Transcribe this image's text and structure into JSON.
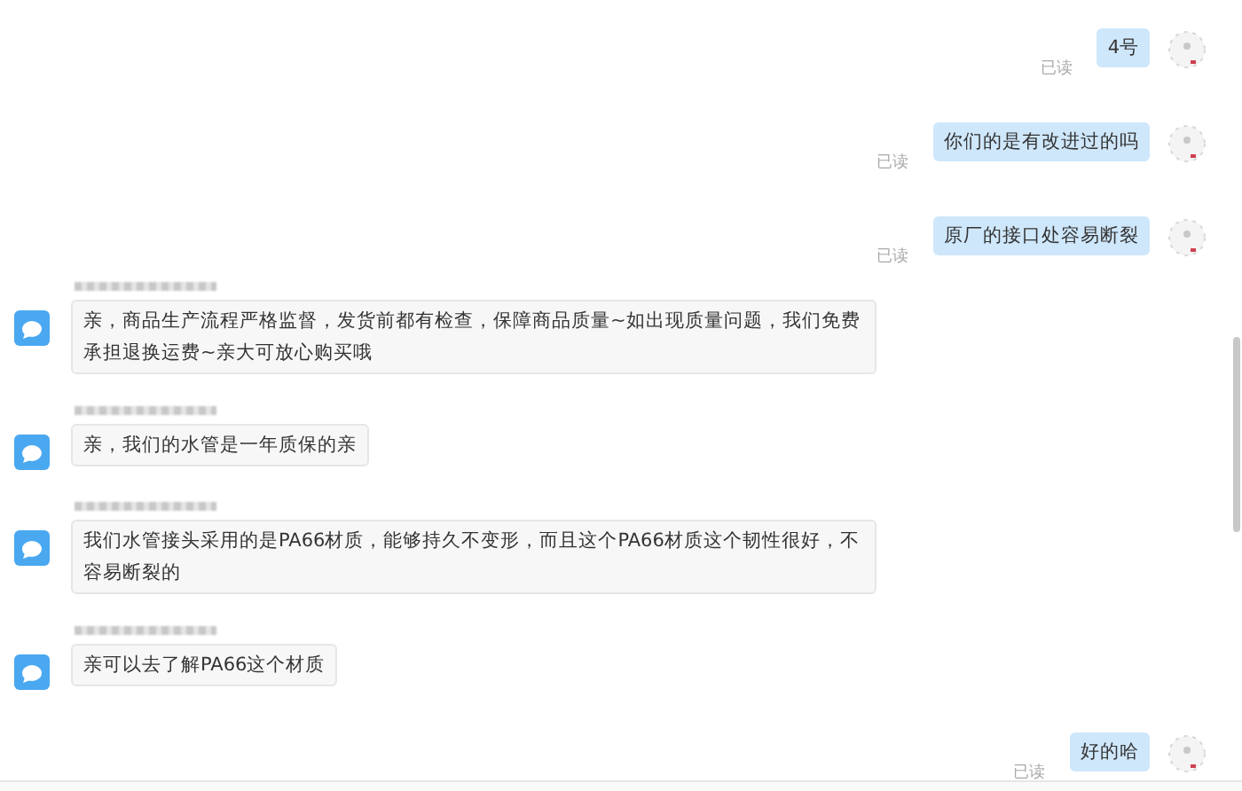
{
  "messages": [
    {
      "kind": "out",
      "text": "4号",
      "read_label": "已读"
    },
    {
      "kind": "out",
      "text": "你们的是有改进过的吗",
      "read_label": "已读"
    },
    {
      "kind": "out",
      "text": "原厂的接口处容易断裂",
      "read_label": "已读"
    },
    {
      "kind": "in",
      "sender_blurred": true,
      "text": "亲，商品生产流程严格监督，发货前都有检查，保障商品质量~如出现质量问题，我们免费承担退换运费~亲大可放心购买哦"
    },
    {
      "kind": "in",
      "sender_blurred": true,
      "text": "亲，我们的水管是一年质保的亲"
    },
    {
      "kind": "in",
      "sender_blurred": true,
      "text": "我们水管接头采用的是PA66材质，能够持久不变形，而且这个PA66材质这个韧性很好，不容易断裂的"
    },
    {
      "kind": "in",
      "sender_blurred": true,
      "text": "亲可以去了解PA66这个材质"
    },
    {
      "kind": "out",
      "text": "好的哈",
      "read_label": "已读"
    }
  ]
}
